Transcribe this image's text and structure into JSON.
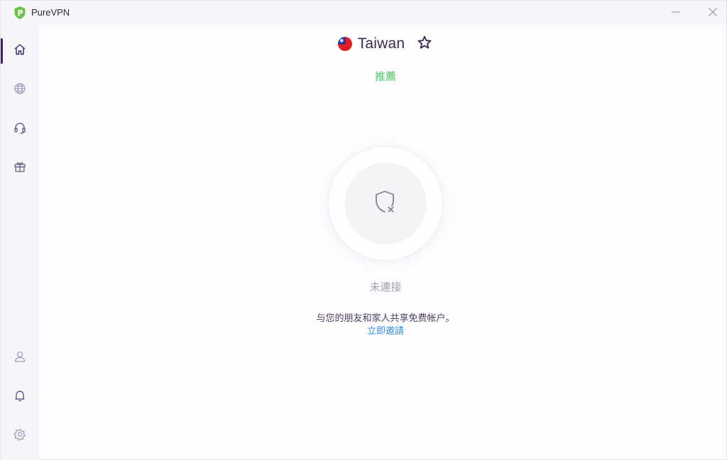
{
  "app": {
    "title": "PureVPN",
    "logo_icon": "purevpn-shield-logo",
    "accent_color": "#3d2266",
    "green_color": "#4fc56a"
  },
  "window_controls": {
    "minimize_icon": "minimize-icon",
    "close_icon": "close-icon"
  },
  "sidebar": {
    "top_items": [
      {
        "icon": "home-icon",
        "active": true
      },
      {
        "icon": "globe-icon",
        "active": false
      },
      {
        "icon": "headset-icon",
        "active": false
      },
      {
        "icon": "gift-icon",
        "active": false
      }
    ],
    "bottom_items": [
      {
        "icon": "user-icon"
      },
      {
        "icon": "bell-icon"
      },
      {
        "icon": "settings-icon"
      }
    ]
  },
  "location": {
    "flag_icon": "taiwan-flag-icon",
    "country": "Taiwan",
    "favorite_icon": "star-icon"
  },
  "recommendation": {
    "label": "推薦"
  },
  "connection": {
    "button_icon": "shield-disconnected-icon",
    "status": "未連接"
  },
  "referral": {
    "message": "与您的朋友和家人共享免费帐户。",
    "link_label": "立即邀請"
  }
}
